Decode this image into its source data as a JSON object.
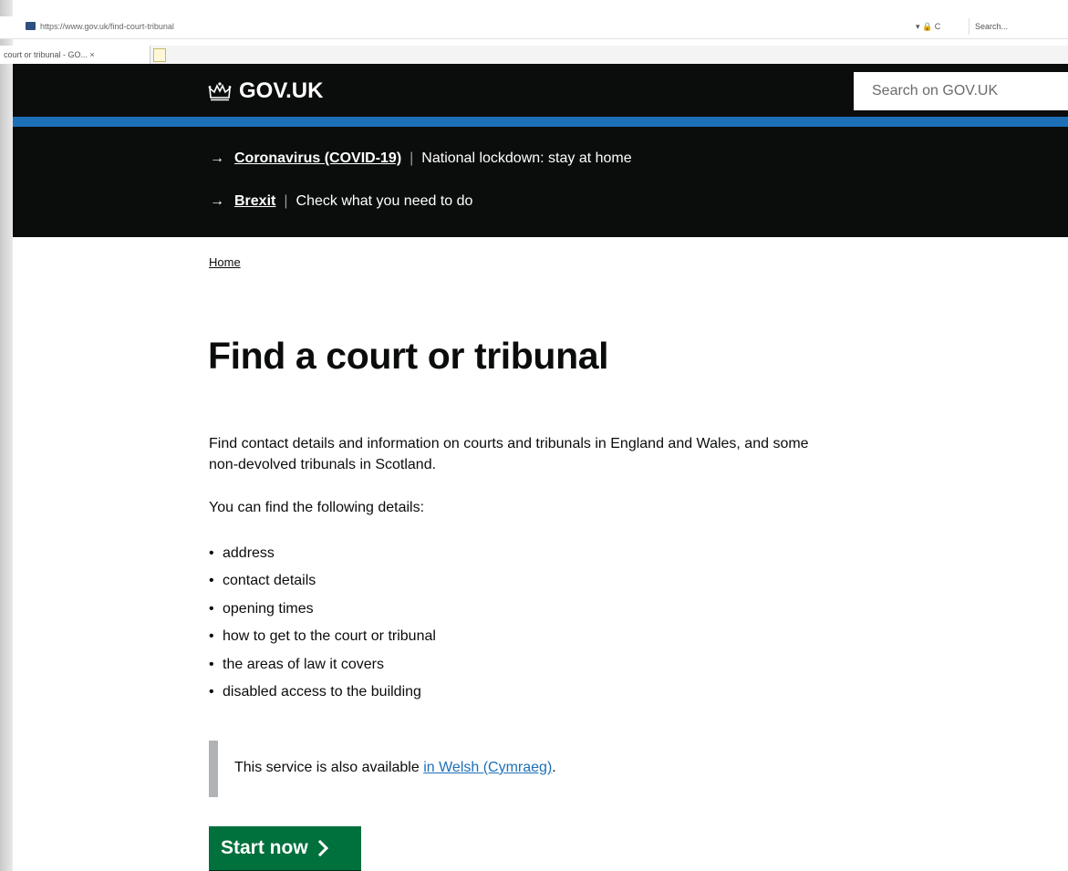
{
  "browser": {
    "url": "https://www.gov.uk/find-court-tribunal",
    "controls": "▾ 🔒 C",
    "search_placeholder": "Search...",
    "tab_title": "court or tribunal - GO... ×"
  },
  "header": {
    "logo_text": "GOV.UK",
    "search_placeholder": "Search on GOV.UK"
  },
  "banner": {
    "items": [
      {
        "link": "Coronavirus (COVID-19)",
        "text": "National lockdown: stay at home"
      },
      {
        "link": "Brexit",
        "text": "Check what you need to do"
      }
    ]
  },
  "breadcrumb": {
    "home": "Home"
  },
  "main": {
    "title": "Find a court or tribunal",
    "intro": "Find contact details and information on courts and tribunals in England and Wales, and some non-devolved tribunals in Scotland.",
    "details_heading": "You can find the following details:",
    "details": [
      "address",
      "contact details",
      "opening times",
      "how to get to the court or tribunal",
      "the areas of law it covers",
      "disabled access to the building"
    ],
    "welsh_text": "This service is also available ",
    "welsh_link": "in Welsh (Cymraeg)",
    "welsh_end": ".",
    "start_button": "Start now"
  },
  "colors": {
    "header_bg": "#0b0c0c",
    "blue_bar": "#1d70b8",
    "button_green": "#00703c",
    "link_blue": "#1d70b8"
  }
}
